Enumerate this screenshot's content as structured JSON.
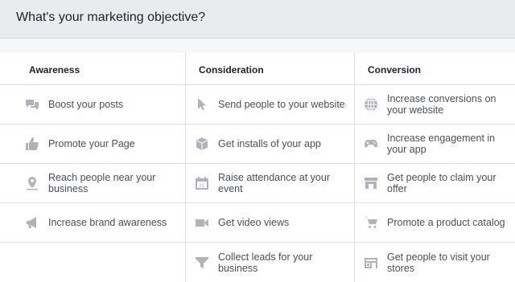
{
  "header": {
    "title": "What's your marketing objective?"
  },
  "columns": [
    {
      "title": "Awareness",
      "items": [
        {
          "label": "Boost your posts",
          "icon": "boost-posts-icon"
        },
        {
          "label": "Promote your Page",
          "icon": "thumbs-up-icon"
        },
        {
          "label": "Reach people near your business",
          "icon": "location-pin-icon"
        },
        {
          "label": "Increase brand awareness",
          "icon": "megaphone-icon"
        }
      ]
    },
    {
      "title": "Consideration",
      "items": [
        {
          "label": "Send people to your website",
          "icon": "cursor-icon"
        },
        {
          "label": "Get installs of your app",
          "icon": "box-icon"
        },
        {
          "label": "Raise attendance at your event",
          "icon": "calendar-icon"
        },
        {
          "label": "Get video views",
          "icon": "video-camera-icon"
        },
        {
          "label": "Collect leads for your business",
          "icon": "funnel-icon"
        }
      ]
    },
    {
      "title": "Conversion",
      "items": [
        {
          "label": "Increase conversions on your website",
          "icon": "globe-icon"
        },
        {
          "label": "Increase engagement in your app",
          "icon": "gamepad-icon"
        },
        {
          "label": "Get people to claim your offer",
          "icon": "storefront-icon"
        },
        {
          "label": "Promote a product catalog",
          "icon": "shopping-cart-icon"
        },
        {
          "label": "Get people to visit your stores",
          "icon": "store-icon"
        }
      ]
    }
  ]
}
